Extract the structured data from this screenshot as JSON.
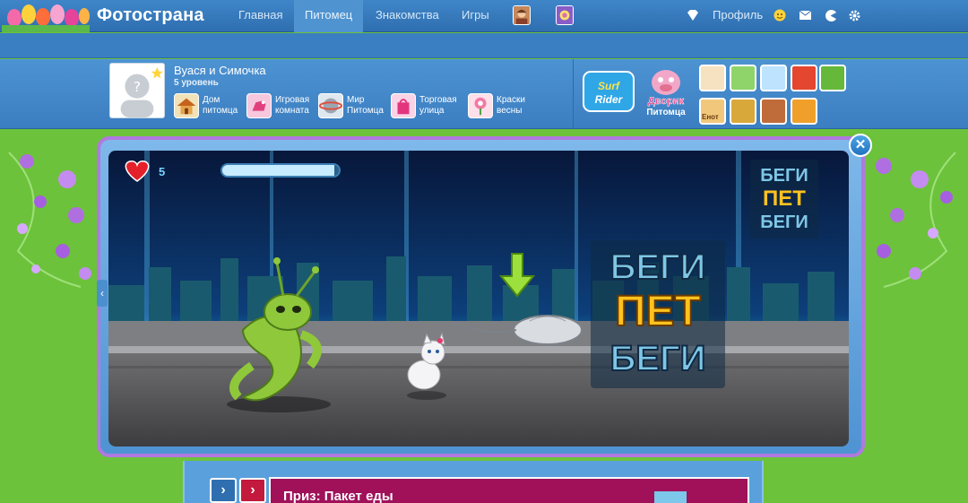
{
  "app": {
    "brand": "Фотострана"
  },
  "nav": {
    "items": [
      "Главная",
      "Питомец",
      "Знакомства",
      "Игры"
    ],
    "active_index": 1,
    "profile": "Профиль"
  },
  "pet": {
    "name": "Вуася и Симочка",
    "level": "5 уровень",
    "shortcuts": [
      {
        "label": "Дом питомца",
        "icon": "house-icon"
      },
      {
        "label": "Игровая комната",
        "icon": "horse-toy-icon"
      },
      {
        "label": "Мир Питомца",
        "icon": "globe-icon"
      },
      {
        "label": "Торговая улица",
        "icon": "shopping-bag-icon"
      },
      {
        "label": "Краски весны",
        "icon": "spring-flower-icon"
      }
    ],
    "game_logos": [
      {
        "line1": "Surf",
        "line2": "Rider"
      },
      {
        "line1": "Дворик",
        "line2": "Питомца"
      }
    ],
    "small_tile_extra_label": "Енот"
  },
  "game": {
    "lives": "5",
    "energy_fill": 0.96,
    "title_lines": [
      "БЕГИ",
      "ПЕТ",
      "БЕГИ"
    ]
  },
  "prize": {
    "text": "Приз: Пакет еды"
  },
  "colors": {
    "nav_bg": "#2f6fb0",
    "grass": "#6cc23a",
    "frame_border": "#b079e0",
    "prize_bg": "#a0115a"
  }
}
